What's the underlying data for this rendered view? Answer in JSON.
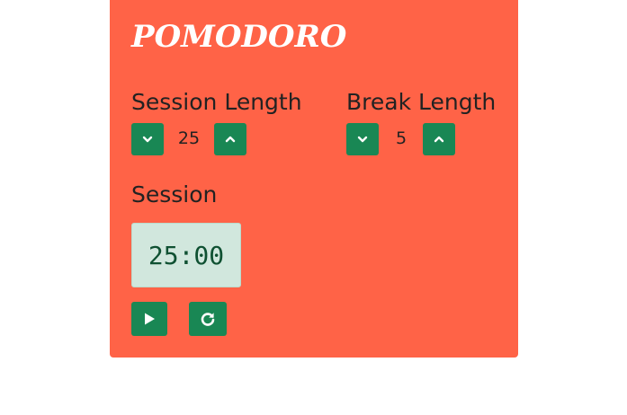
{
  "app": {
    "title": "POMODORO"
  },
  "session_length": {
    "label": "Session Length",
    "value": "25",
    "decrement_icon": "chevron-down-icon",
    "increment_icon": "chevron-up-icon"
  },
  "break_length": {
    "label": "Break Length",
    "value": "5",
    "decrement_icon": "chevron-down-icon",
    "increment_icon": "chevron-up-icon"
  },
  "timer": {
    "label": "Session",
    "display": "25:00"
  },
  "controls": {
    "play_icon": "play-icon",
    "reset_icon": "reset-icon"
  },
  "colors": {
    "card_background": "#ff6347",
    "button": "#198754",
    "timer_background": "#d1e7dd",
    "timer_text": "#0f5132",
    "title_text": "#ffffff"
  }
}
